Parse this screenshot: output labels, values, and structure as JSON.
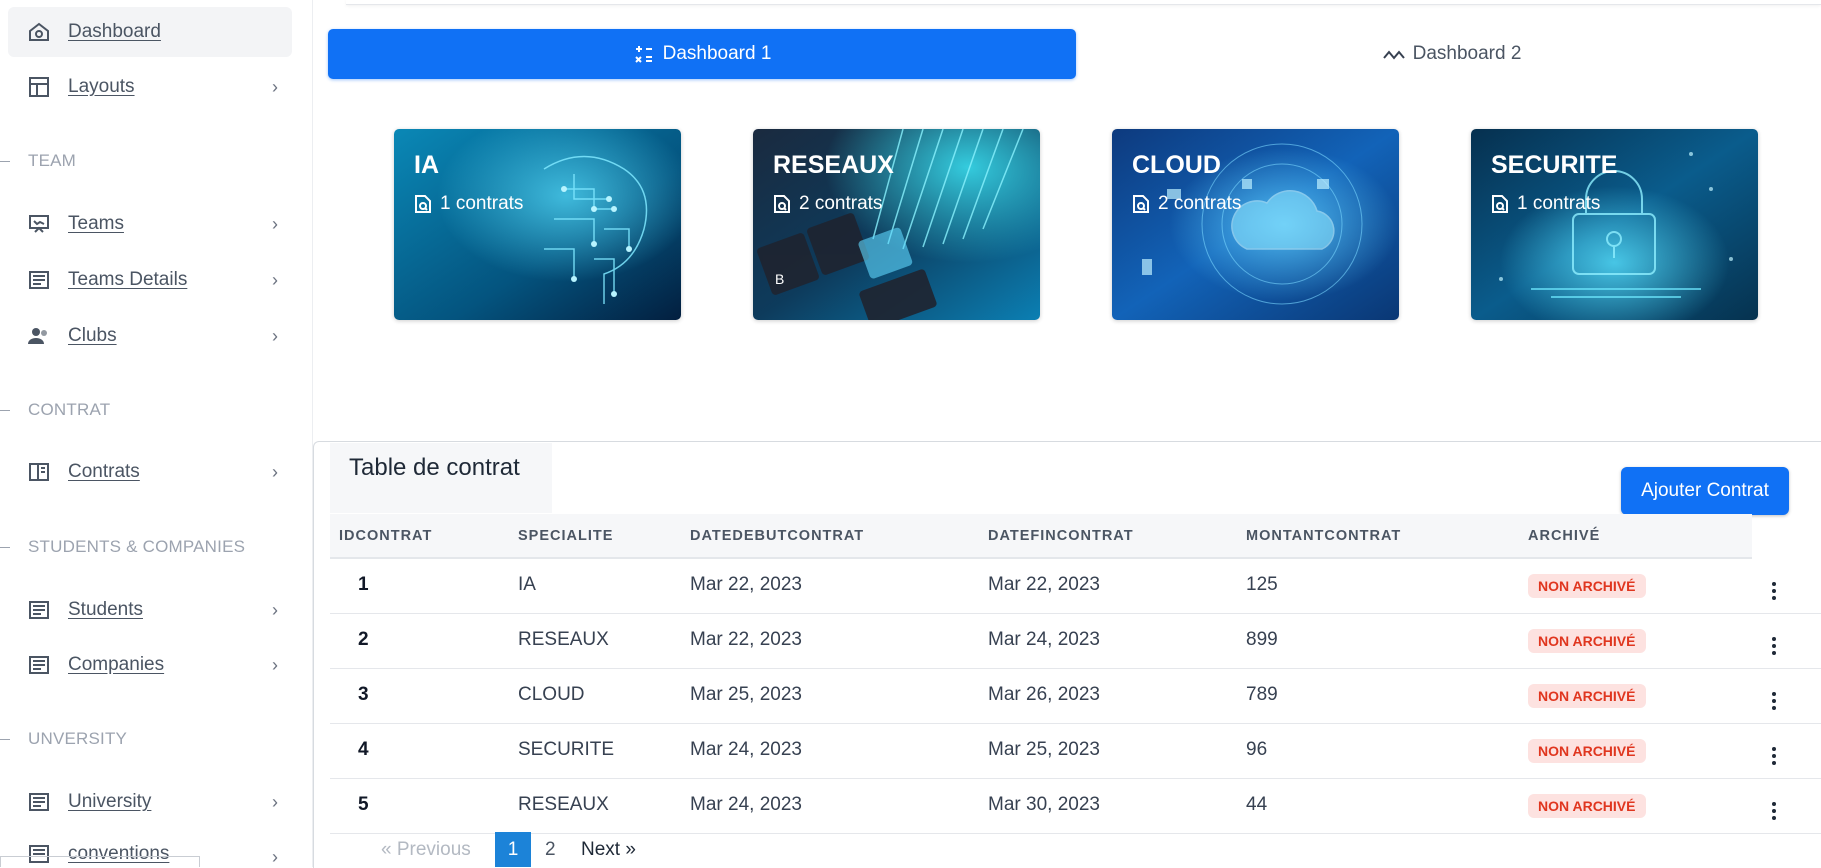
{
  "sidebar": {
    "items": [
      {
        "label": "Dashboard",
        "icon": "home-icon"
      },
      {
        "label": "Layouts",
        "icon": "layout-icon"
      },
      {
        "label": "Teams",
        "icon": "presentation-icon"
      },
      {
        "label": "Teams Details",
        "icon": "document-icon"
      },
      {
        "label": "Clubs",
        "icon": "users-icon"
      },
      {
        "label": "Contrats",
        "icon": "book-icon"
      },
      {
        "label": "Students",
        "icon": "document-icon"
      },
      {
        "label": "Companies",
        "icon": "document-icon"
      },
      {
        "label": "University",
        "icon": "document-icon"
      },
      {
        "label": "conventions",
        "icon": "document-icon"
      }
    ],
    "sections": [
      "TEAM",
      "CONTRAT",
      "STUDENTS & COMPANIES",
      "UNVERSITY"
    ]
  },
  "tabs": [
    {
      "label": "Dashboard 1",
      "icon": "calculator-icon",
      "active": true
    },
    {
      "label": "Dashboard 2",
      "icon": "activity-icon",
      "active": false
    }
  ],
  "cards": [
    {
      "title": "IA",
      "subtitle": "1 contrats"
    },
    {
      "title": "RESEAUX",
      "subtitle": "2 contrats"
    },
    {
      "title": "CLOUD",
      "subtitle": "2 contrats"
    },
    {
      "title": "SECURITE",
      "subtitle": "1 contrats"
    }
  ],
  "table": {
    "title": "Table de contrat",
    "add_button": "Ajouter Contrat",
    "columns": [
      "IDCONTRAT",
      "SPECIALITE",
      "DATEDEBUTCONTRAT",
      "DATEFINCONTRAT",
      "MONTANTCONTRAT",
      "ARCHIVÉ"
    ],
    "rows": [
      {
        "id": "1",
        "specialite": "IA",
        "debut": "Mar 22, 2023",
        "fin": "Mar 22, 2023",
        "montant": "125",
        "archive": "NON ARCHIVÉ"
      },
      {
        "id": "2",
        "specialite": "RESEAUX",
        "debut": "Mar 22, 2023",
        "fin": "Mar 24, 2023",
        "montant": "899",
        "archive": "NON ARCHIVÉ"
      },
      {
        "id": "3",
        "specialite": "CLOUD",
        "debut": "Mar 25, 2023",
        "fin": "Mar 26, 2023",
        "montant": "789",
        "archive": "NON ARCHIVÉ"
      },
      {
        "id": "4",
        "specialite": "SECURITE",
        "debut": "Mar 24, 2023",
        "fin": "Mar 25, 2023",
        "montant": "96",
        "archive": "NON ARCHIVÉ"
      },
      {
        "id": "5",
        "specialite": "RESEAUX",
        "debut": "Mar 24, 2023",
        "fin": "Mar 30, 2023",
        "montant": "44",
        "archive": "NON ARCHIVÉ"
      }
    ]
  },
  "pagination": {
    "prev": "«  Previous",
    "pages": [
      "1",
      "2"
    ],
    "current": "1",
    "next": "Next  »"
  },
  "colors": {
    "primary": "#1071f5",
    "badge_bg": "#fde2e0",
    "badge_text": "#e0361f"
  }
}
